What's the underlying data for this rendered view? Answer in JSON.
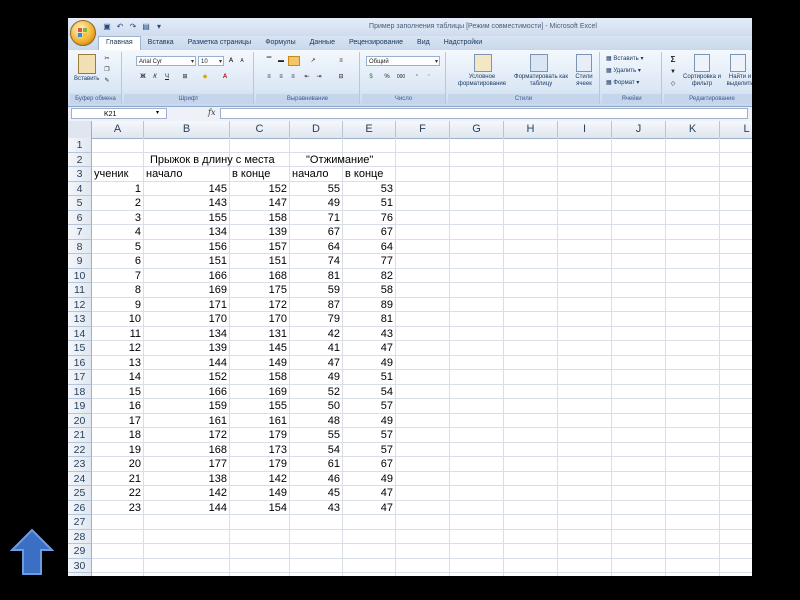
{
  "window": {
    "title": "Пример заполнения таблицы  [Режим совместимости] - Microsoft Excel"
  },
  "ribbon_tabs": [
    "Главная",
    "Вставка",
    "Разметка страницы",
    "Формулы",
    "Данные",
    "Рецензирование",
    "Вид",
    "Надстройки"
  ],
  "ribbon": {
    "clipboard": {
      "paste_label": "Вставить",
      "group_label": "Буфер обмена"
    },
    "font": {
      "font_name": "Arial Cyr",
      "font_size": "10",
      "bold": "Ж",
      "italic": "К",
      "underline": "Ч",
      "grow": "A",
      "shrink": "A",
      "group_label": "Шрифт"
    },
    "alignment": {
      "group_label": "Выравнивание"
    },
    "number": {
      "format": "Общий",
      "percent": "%",
      "thousands": "000",
      "group_label": "Число"
    },
    "styles": {
      "conditional": "Условное форматирование",
      "as_table": "Форматировать как таблицу",
      "cell_styles": "Стили ячеек",
      "group_label": "Стили"
    },
    "cells": {
      "insert": "Вставить",
      "delete": "Удалить",
      "format": "Формат",
      "group_label": "Ячейки"
    },
    "editing": {
      "sigma": "Σ",
      "sort": "Сортировка и фильтр",
      "find": "Найти и выделить",
      "group_label": "Редактирование"
    }
  },
  "formula_bar": {
    "name_box": "K21",
    "fx": "fx",
    "formula": ""
  },
  "columns": [
    "A",
    "B",
    "C",
    "D",
    "E",
    "F",
    "G",
    "H",
    "I",
    "J",
    "K",
    "L"
  ],
  "rows": [
    {
      "n": "1",
      "cells": [
        "",
        "",
        "",
        "",
        ""
      ]
    },
    {
      "n": "2",
      "cells": [
        "",
        "Прыжок в длину с места",
        "",
        "\"Отжимание\"",
        ""
      ]
    },
    {
      "n": "3",
      "cells": [
        "ученик",
        "начало",
        "в конце",
        "начало",
        "в конце"
      ]
    },
    {
      "n": "4",
      "cells": [
        "1",
        "145",
        "152",
        "55",
        "53"
      ]
    },
    {
      "n": "5",
      "cells": [
        "2",
        "143",
        "147",
        "49",
        "51"
      ]
    },
    {
      "n": "6",
      "cells": [
        "3",
        "155",
        "158",
        "71",
        "76"
      ]
    },
    {
      "n": "7",
      "cells": [
        "4",
        "134",
        "139",
        "67",
        "67"
      ]
    },
    {
      "n": "8",
      "cells": [
        "5",
        "156",
        "157",
        "64",
        "64"
      ]
    },
    {
      "n": "9",
      "cells": [
        "6",
        "151",
        "151",
        "74",
        "77"
      ]
    },
    {
      "n": "10",
      "cells": [
        "7",
        "166",
        "168",
        "81",
        "82"
      ]
    },
    {
      "n": "11",
      "cells": [
        "8",
        "169",
        "175",
        "59",
        "58"
      ]
    },
    {
      "n": "12",
      "cells": [
        "9",
        "171",
        "172",
        "87",
        "89"
      ]
    },
    {
      "n": "13",
      "cells": [
        "10",
        "170",
        "170",
        "79",
        "81"
      ]
    },
    {
      "n": "14",
      "cells": [
        "11",
        "134",
        "131",
        "42",
        "43"
      ]
    },
    {
      "n": "15",
      "cells": [
        "12",
        "139",
        "145",
        "41",
        "47"
      ]
    },
    {
      "n": "16",
      "cells": [
        "13",
        "144",
        "149",
        "47",
        "49"
      ]
    },
    {
      "n": "17",
      "cells": [
        "14",
        "152",
        "158",
        "49",
        "51"
      ]
    },
    {
      "n": "18",
      "cells": [
        "15",
        "166",
        "169",
        "52",
        "54"
      ]
    },
    {
      "n": "19",
      "cells": [
        "16",
        "159",
        "155",
        "50",
        "57"
      ]
    },
    {
      "n": "20",
      "cells": [
        "17",
        "161",
        "161",
        "48",
        "49"
      ]
    },
    {
      "n": "21",
      "cells": [
        "18",
        "172",
        "179",
        "55",
        "57"
      ]
    },
    {
      "n": "22",
      "cells": [
        "19",
        "168",
        "173",
        "54",
        "57"
      ]
    },
    {
      "n": "23",
      "cells": [
        "20",
        "177",
        "179",
        "61",
        "67"
      ]
    },
    {
      "n": "24",
      "cells": [
        "21",
        "138",
        "142",
        "46",
        "49"
      ]
    },
    {
      "n": "25",
      "cells": [
        "22",
        "142",
        "149",
        "45",
        "47"
      ]
    },
    {
      "n": "26",
      "cells": [
        "23",
        "144",
        "154",
        "43",
        "47"
      ]
    },
    {
      "n": "27",
      "cells": [
        "",
        "",
        "",
        "",
        ""
      ]
    },
    {
      "n": "28",
      "cells": [
        "",
        "",
        "",
        "",
        ""
      ]
    },
    {
      "n": "29",
      "cells": [
        "",
        "",
        "",
        "",
        ""
      ]
    },
    {
      "n": "30",
      "cells": [
        "",
        "",
        "",
        "",
        ""
      ]
    },
    {
      "n": "31",
      "cells": [
        "",
        "",
        "",
        "",
        ""
      ]
    }
  ],
  "colors": {
    "arrow": "#3b6fc4",
    "ribbon_blue": "#dbe7f5",
    "header_text": "#27415f"
  },
  "icons": {
    "nav": "up-arrow-icon",
    "office": "office-button-icon"
  }
}
